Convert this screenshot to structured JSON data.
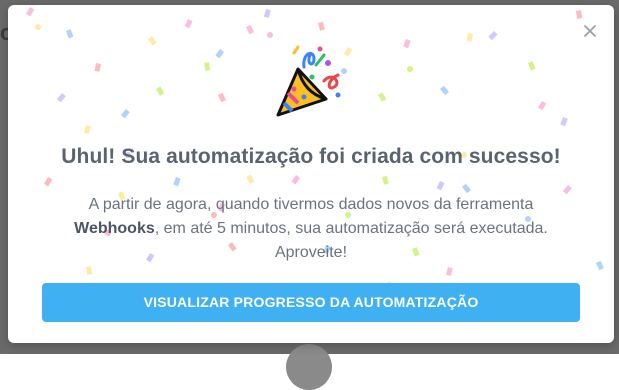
{
  "modal": {
    "title": "Uhul! Sua automatização foi criada com sucesso!",
    "body_intro": "A partir de agora, quando tivermos dados novos da ferramenta",
    "tool_name": "Webhooks",
    "body_rest": ", em até 5 minutos, sua automatização será executada. Aproveite!",
    "cta_label": "VISUALIZAR PROGRESSO DA AUTOMATIZAÇÃO",
    "close_icon": "close-icon",
    "illustration_icon": "party-popper-icon"
  },
  "background": {
    "peek_text": "ca"
  },
  "colors": {
    "accent": "#3fb1f2",
    "title": "#5a6470",
    "body": "#6b7280",
    "overlay": "#6a6a6a"
  }
}
